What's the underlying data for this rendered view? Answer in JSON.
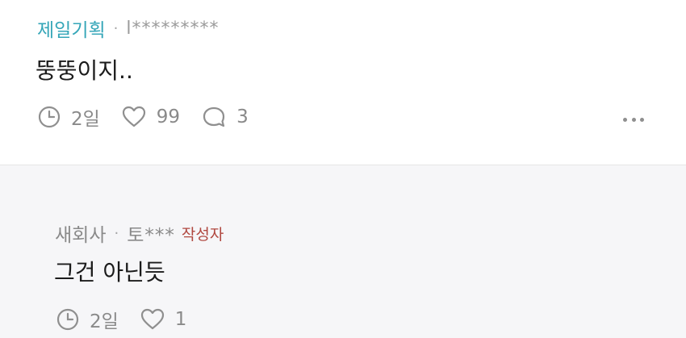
{
  "comments": [
    {
      "company": "제일기획",
      "separator": "·",
      "nickname": "l*********",
      "text": "뚱뚱이지..",
      "time": "2일",
      "likes": "99",
      "replies": "3"
    }
  ],
  "reply": {
    "company": "새회사",
    "separator": "·",
    "nickname": "토***",
    "author_badge": "작성자",
    "text": "그건 아닌듯",
    "time": "2일",
    "likes": "1"
  },
  "icons": {
    "time": "clock-icon",
    "like": "heart-icon",
    "reply": "speech-bubble-icon",
    "more": "more-horizontal-icon"
  },
  "colors": {
    "company_accent": "#35a6b8",
    "author_badge": "#b0473f",
    "reply_background": "#f6f6f8"
  }
}
